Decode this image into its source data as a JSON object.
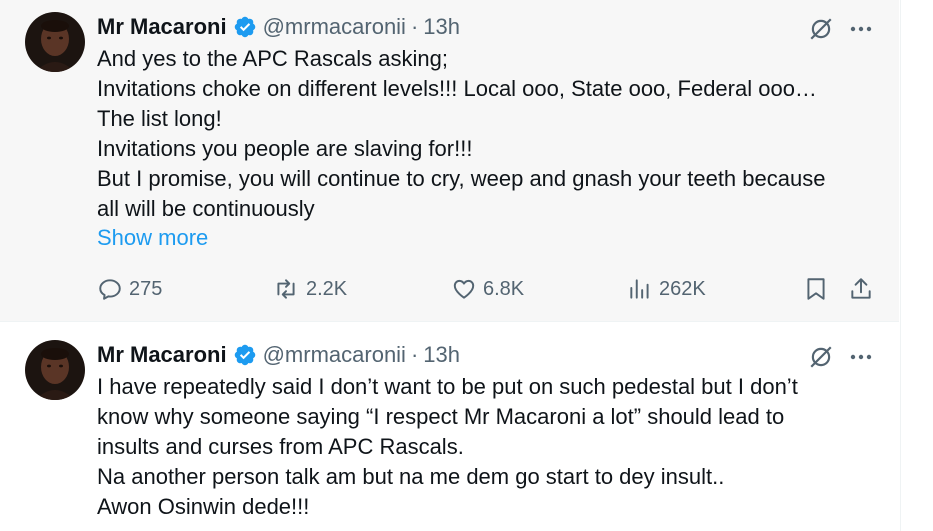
{
  "tweets": [
    {
      "author_name": "Mr Macaroni",
      "handle": "@mrmacaronii",
      "separator": "·",
      "time": "13h",
      "lines": [
        "And yes to the APC Rascals asking;",
        "Invitations choke on different levels!!! Local ooo, State ooo, Federal ooo…",
        "The list long!",
        "Invitations you people are slaving for!!!",
        "But I promise, you will continue to cry, weep and gnash your teeth because",
        "all will be continuously"
      ],
      "show_more": "Show more",
      "replies": "275",
      "reposts": "2.2K",
      "likes": "6.8K",
      "views": "262K"
    },
    {
      "author_name": "Mr Macaroni",
      "handle": "@mrmacaronii",
      "separator": "·",
      "time": "13h",
      "lines": [
        "I have repeatedly said I don’t want to be put on such pedestal but I don’t",
        "know why someone saying  “I respect Mr Macaroni a lot”  should lead to",
        "insults and curses from APC Rascals.",
        "Na another person talk am but na me dem go start to dey insult..",
        "Awon Osinwin dede!!!"
      ]
    }
  ],
  "colors": {
    "accent": "#1d9bf0",
    "muted": "#536471",
    "text": "#0f1419",
    "highlight_bg": "#f7f7f7"
  },
  "icons": [
    "verified-badge-icon",
    "grok-icon",
    "more-icon",
    "reply-icon",
    "repost-icon",
    "like-icon",
    "views-icon",
    "bookmark-icon",
    "share-icon"
  ]
}
